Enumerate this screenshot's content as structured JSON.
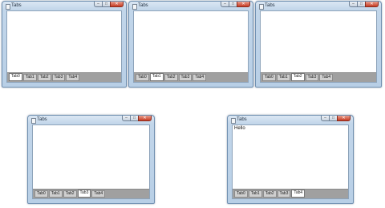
{
  "windows": [
    {
      "title": "Tabs",
      "content_text": "",
      "tabs": [
        "Tab0",
        "Tab1",
        "Tab2",
        "Tab3",
        "Tab4"
      ],
      "active_tab": "Tab0"
    },
    {
      "title": "Tabs",
      "content_text": "",
      "tabs": [
        "Tab0",
        "Tab1",
        "Tab2",
        "Tab3",
        "Tab4"
      ],
      "active_tab": "Tab1"
    },
    {
      "title": "Tabs",
      "content_text": "",
      "tabs": [
        "Tab0",
        "Tab1",
        "Tab2",
        "Tab3",
        "Tab4"
      ],
      "active_tab": "Tab2"
    },
    {
      "title": "Tabs",
      "content_text": "",
      "tabs": [
        "Tab0",
        "Tab1",
        "Tab2",
        "Tab3",
        "Tab4"
      ],
      "active_tab": "Tab3"
    },
    {
      "title": "Tabs",
      "content_text": "Hello",
      "tabs": [
        "Tab0",
        "Tab1",
        "Tab2",
        "Tab3",
        "Tab4"
      ],
      "active_tab": "Tab4"
    }
  ],
  "caption_buttons": {
    "minimize_glyph": "–",
    "maximize_glyph": "□",
    "close_glyph": "✕"
  },
  "icons": {
    "app_icon": "window-app-icon",
    "minimize": "minimize-icon",
    "maximize": "maximize-icon",
    "close": "close-icon"
  },
  "colors": {
    "frame": "#c2d6ea",
    "close_button": "#c83c23",
    "tab_strip": "#a0a0a0",
    "tab_active": "#ffffff",
    "tab_inactive": "#cfcfcf"
  }
}
